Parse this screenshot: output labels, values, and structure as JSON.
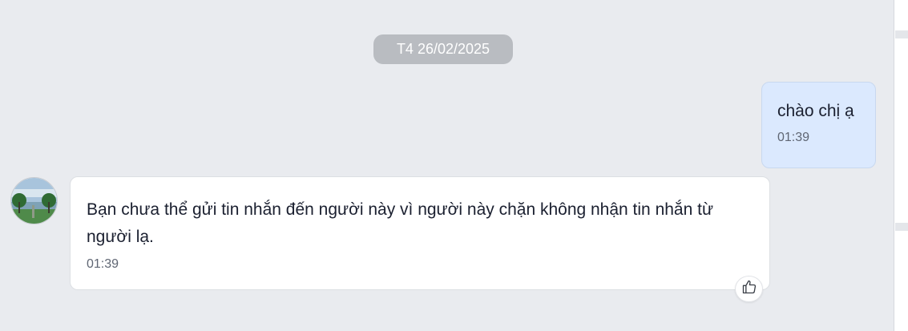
{
  "date_separator": "T4 26/02/2025",
  "messages": [
    {
      "direction": "outgoing",
      "text": "chào chị ạ",
      "time": "01:39"
    },
    {
      "direction": "incoming",
      "text": "Bạn chưa thể gửi tin nhắn đến người này vì người này chặn không nhận tin nhắn từ người lạ.",
      "time": "01:39"
    }
  ],
  "icons": {
    "reaction": "thumbs-up-icon",
    "avatar": "contact-avatar"
  },
  "colors": {
    "background": "#e9ebef",
    "outgoing_bubble": "#dbe9fe",
    "incoming_bubble": "#ffffff",
    "date_pill": "#b9bcc1"
  }
}
